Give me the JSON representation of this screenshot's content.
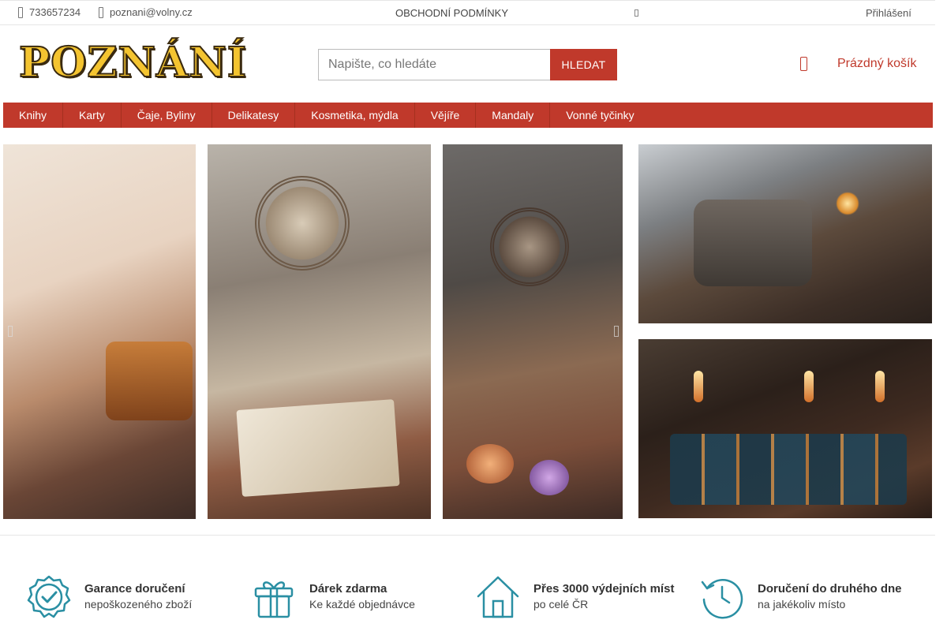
{
  "topbar": {
    "phone": "733657234",
    "email": "poznani@volny.cz",
    "terms": "OBCHODNÍ PODMÍNKY",
    "login": "Přihlášení"
  },
  "header": {
    "logo_text": "POZNÁNÍ",
    "search_placeholder": "Napište, co hledáte",
    "search_button": "HLEDAT",
    "cart_label": "Prázdný košík"
  },
  "nav": {
    "items": [
      "Knihy",
      "Karty",
      "Čaje, Byliny",
      "Delikatesy",
      "Kosmetika, mýdla",
      "Vějíře",
      "Mandaly",
      "Vonné tyčinky"
    ]
  },
  "colors": {
    "accent": "#c0392b",
    "logo": "#f4c430"
  },
  "features": [
    {
      "title": "Garance doručení",
      "subtitle": "nepoškozeného zboží",
      "icon": "badge-check-icon"
    },
    {
      "title": "Dárek zdarma",
      "subtitle": "Ke každé objednávce",
      "icon": "gift-icon"
    },
    {
      "title": "Přes 3000 výdejních míst",
      "subtitle": "po celé ČR",
      "icon": "home-icon"
    },
    {
      "title": "Doručení do druhého dne",
      "subtitle": "na jakékoliv místo",
      "icon": "history-clock-icon"
    }
  ]
}
